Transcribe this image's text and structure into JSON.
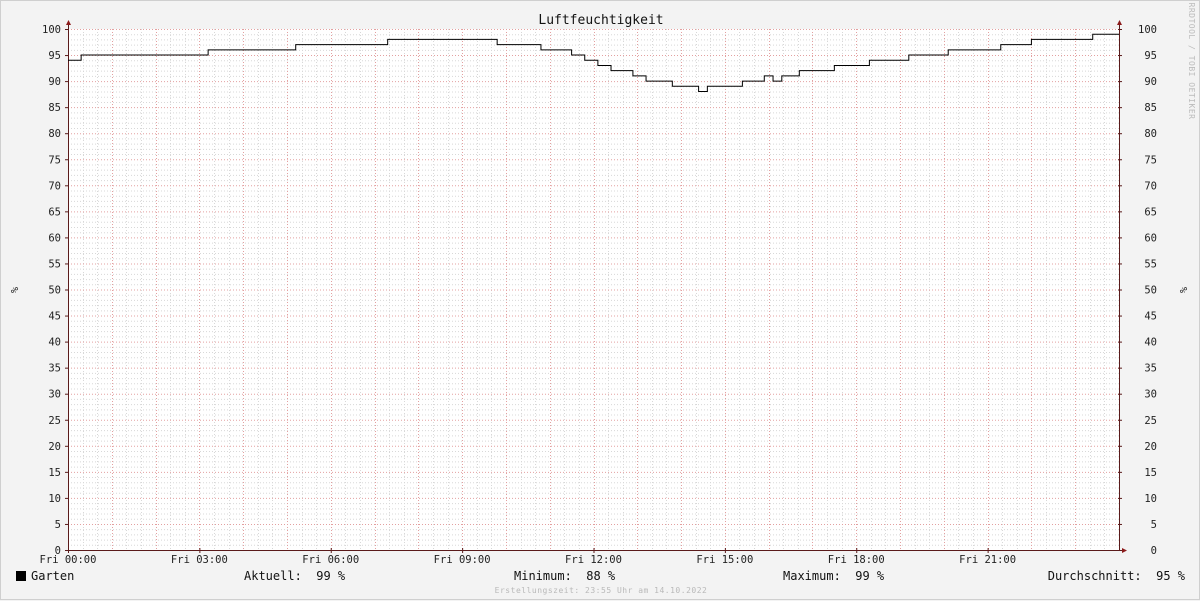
{
  "chart_data": {
    "type": "line",
    "title": "Luftfeuchtigkeit",
    "ylabel_left": "%",
    "ylabel_right": "%",
    "ylim": [
      0,
      100
    ],
    "y_ticks": [
      "0",
      "5",
      "10",
      "15",
      "20",
      "25",
      "30",
      "35",
      "40",
      "45",
      "50",
      "55",
      "60",
      "65",
      "70",
      "75",
      "80",
      "85",
      "90",
      "95",
      "100"
    ],
    "xlim": [
      0,
      24
    ],
    "x_ticks": [
      {
        "at": 0,
        "label": "Fri 00:00"
      },
      {
        "at": 3,
        "label": "Fri 03:00"
      },
      {
        "at": 6,
        "label": "Fri 06:00"
      },
      {
        "at": 9,
        "label": "Fri 09:00"
      },
      {
        "at": 12,
        "label": "Fri 12:00"
      },
      {
        "at": 15,
        "label": "Fri 15:00"
      },
      {
        "at": 18,
        "label": "Fri 18:00"
      },
      {
        "at": 21,
        "label": "Fri 21:00"
      }
    ],
    "grid": true,
    "series": [
      {
        "name": "Garten",
        "color": "#000000",
        "step": true,
        "x": [
          0,
          0.3,
          1.6,
          3.2,
          5.2,
          7.3,
          9.8,
          10.8,
          11.5,
          11.8,
          12.1,
          12.4,
          12.9,
          13.2,
          13.8,
          14.4,
          14.6,
          14.8,
          15.4,
          15.9,
          16.1,
          16.3,
          16.7,
          17.5,
          18.3,
          19.2,
          20.1,
          21.3,
          22.0,
          23.4,
          24.0
        ],
        "values": [
          94,
          95,
          95,
          96,
          97,
          98,
          97,
          96,
          95,
          94,
          93,
          92,
          91,
          90,
          89,
          88,
          89,
          89,
          90,
          91,
          90,
          91,
          92,
          93,
          94,
          95,
          96,
          97,
          98,
          99,
          99
        ]
      }
    ]
  },
  "legend": {
    "series_name": "Garten",
    "series_color": "#000000",
    "current": "Aktuell:  99 %",
    "minimum": "Minimum:  88 %",
    "maximum": "Maximum:  99 %",
    "average": "Durchschnitt:  95 %"
  },
  "watermark": "RRDTOOL / TOBI OETIKER",
  "footer": "Erstellungszeit: 23:55 Uhr am 14.10.2022",
  "colors": {
    "background": "#f3f3f3",
    "canvas": "#ffffff",
    "major_grid": "#e3a0a0",
    "minor_grid": "#d8d8d8",
    "axis": "#5a1a1a",
    "arrow": "#8b1a1a"
  }
}
